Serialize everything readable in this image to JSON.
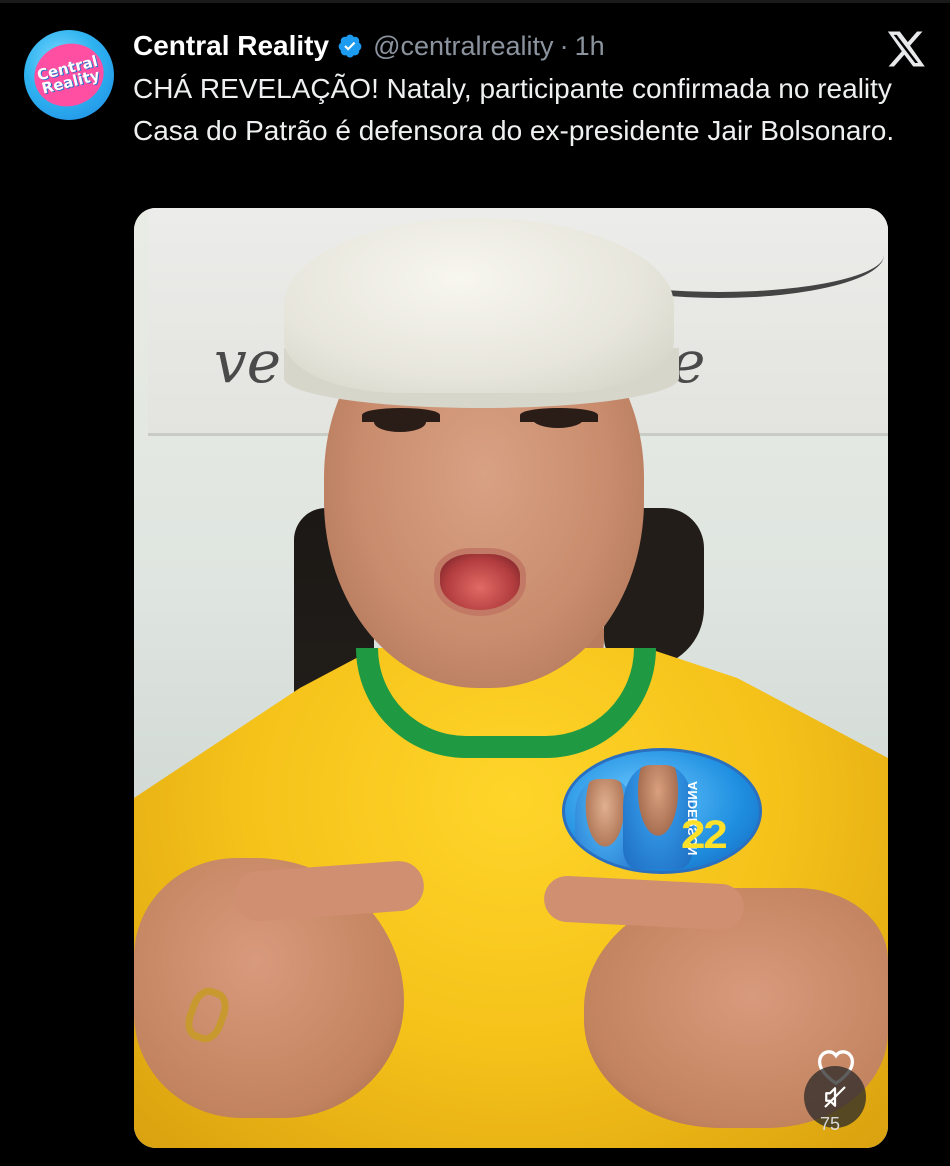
{
  "tweet": {
    "avatar_text_line1": "Central",
    "avatar_text_line2": "Reality",
    "display_name": "Central Reality",
    "verified": true,
    "handle": "@centralreality",
    "separator": "·",
    "time": "1h",
    "text": "CHÁ REVELAÇÃO! Nataly, participante confirmada no reality Casa do Patrão é defensora do ex-presidente Jair Bolsonaro."
  },
  "platform": {
    "logo_icon": "x-logo-icon"
  },
  "media": {
    "type": "video-frame",
    "sticker_number": "22",
    "sticker_name": "ANDERSON",
    "like_icon": "heart-icon",
    "mute_icon": "muted-speaker-icon",
    "view_count": "75"
  },
  "colors": {
    "background": "#000000",
    "name": "#ffffff",
    "secondary": "#8b949e",
    "verified": "#1d9bf0",
    "shirt": "#f5c21a",
    "collar": "#1f9a43"
  }
}
